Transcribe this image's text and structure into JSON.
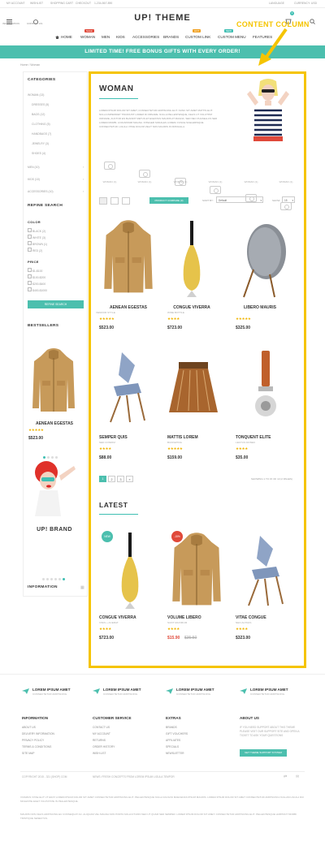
{
  "topbar": {
    "links": [
      "My Account",
      "Wishlist",
      "Shopping Cart",
      "Checkout",
      "1-234-567-890"
    ],
    "lang": "Language",
    "currency": "Currency: USD"
  },
  "header": {
    "logo": "UP! THEME",
    "left_icons": [
      "Information",
      "Contact Us"
    ],
    "cart_count": "3"
  },
  "nav": {
    "items": [
      "Home",
      "Woman",
      "Men",
      "Kids",
      "Accessories",
      "Brands",
      "Custom Link",
      "Custom Menu",
      "Features"
    ],
    "tags": [
      "Sale",
      "Hot",
      "New"
    ]
  },
  "promo": "LIMITED TIME! FREE BONUS GIFTS WITH EVERY ORDER!",
  "callout": "CONTENT COLUMN",
  "breadcrumb": "Home / Woman",
  "sidebar": {
    "categories_title": "Categories",
    "categories": [
      {
        "label": "Woman (13)",
        "active": true
      },
      {
        "label": "Dresses (5)"
      },
      {
        "label": "Bags (12)"
      },
      {
        "label": "Clothing (5)"
      },
      {
        "label": "Handbags (7)"
      },
      {
        "label": "Jewelry (3)"
      },
      {
        "label": "Shoes (4)"
      },
      {
        "label": "Men (10)"
      },
      {
        "label": "Kids (10)"
      },
      {
        "label": "Accessories (10)"
      }
    ],
    "refine_title": "Refine Search",
    "color_title": "Color",
    "colors": [
      "Black (2)",
      "White (3)",
      "Brown (1)",
      "Red (2)"
    ],
    "price_title": "Price",
    "prices": [
      "$1-$100",
      "$100-$200",
      "$200-$400",
      "$400-$1000"
    ],
    "refine_button": "Refine Search",
    "bestsellers_title": "Bestsellers",
    "bestseller_name": "Aenean Egestas",
    "bestseller_rating": "★★★★★",
    "bestseller_price": "$523.00",
    "brand_text": "UP! BRAND",
    "information_title": "Information"
  },
  "content": {
    "title": "WOMAN",
    "description": "LOREM IPSUM DOLOR SIT AMET, CONSECTETUR ADIPISCING ELIT. NUNC SIT AMET MATTIS ELIT. NULLA IMPERDIET TINCIDUNT LOREM ID ORNARE. NULLA PELLENTESQUE, FELIS UT VOLUTPAT ORNARE, AUCTOR EN BLANDIT METUS ET EGESTAS MAURIS AT MAGNA. SED NEC PHASELLUS SED LOREM MORBI. A DIGNISSIM MAGNA. INTEGER SODALES LOREM. FUSCE SCELERISQUE CONSECTETUR. LIGULA VITAE DOLOR VELIT NON MAURIS IN FRINGILLA.",
    "subcategories": [
      "Woman (1)",
      "Woman (1)",
      "Woman (1)",
      "Woman (1)",
      "Woman (1)",
      "Woman (1)"
    ],
    "toolbar": {
      "compare_button": "Product Compare (0)",
      "sort_label": "Sort By:",
      "sort_value": "Default",
      "show_label": "Show:",
      "show_value": "15"
    },
    "products": [
      {
        "name": "Aenean Egestas",
        "sub": "Vendor Style",
        "rating": "★★★★★",
        "price": "$523.00"
      },
      {
        "name": "Congue Viverra",
        "sub": "Wine Bottle",
        "rating": "★★★★",
        "price": "$723.00"
      },
      {
        "name": "Libero Mauris",
        "sub": "Speaker",
        "rating": "★★★★★",
        "price": "$325.00"
      },
      {
        "name": "Semper Quis",
        "sub": "Sed Condim",
        "rating": "★★★★",
        "price": "$88.00"
      },
      {
        "name": "Mattis Lorem",
        "sub": "Bucketing",
        "rating": "★★★★★",
        "price": "$159.00"
      },
      {
        "name": "Tonquent Elite",
        "sub": "Lectus Donec",
        "rating": "★★★★",
        "price": "$35.00"
      }
    ],
    "pagination": [
      "1",
      "2",
      "3",
      "»"
    ],
    "showing": "SHOWING 1 TO 15 OF 13 (2 PAGES)",
    "latest_title": "LATEST",
    "latest": [
      {
        "name": "Congue Viverra",
        "sub": "Vinis + Acerat",
        "rating": "★★★★",
        "price": "$723.00",
        "badge": "New",
        "badge_color": "#4cbfae"
      },
      {
        "name": "Volume Libero",
        "sub": "Sunt Maximum",
        "rating": "★★★★",
        "price": "$15.90",
        "old_price": "$35.50",
        "badge": "-15%",
        "badge_color": "#e0493a"
      },
      {
        "name": "Vitae Congue",
        "sub": "Neo Altavia",
        "rating": "★★★★",
        "price": "$323.00"
      }
    ]
  },
  "footer": {
    "features": [
      {
        "title": "LOREM IPSUM AMET",
        "sub": "Consectetur Adipiscing"
      },
      {
        "title": "LOREM IPSUM AMET",
        "sub": "Consectetur Adipiscing"
      },
      {
        "title": "LOREM IPSUM AMET",
        "sub": "Consectetur Adipiscing"
      },
      {
        "title": "LOREM IPSUM AMET",
        "sub": "Consectetur Adipiscing"
      }
    ],
    "columns": [
      {
        "title": "Information",
        "links": [
          "About Us",
          "Delivery Information",
          "Privacy Policy",
          "Terms & Conditions",
          "Site Map"
        ]
      },
      {
        "title": "Customer Service",
        "links": [
          "Contact Us",
          "My Account",
          "Returns",
          "Order History",
          "Wish List"
        ]
      },
      {
        "title": "Extras",
        "links": [
          "Brands",
          "Gift Vouchers",
          "Affiliates",
          "Specials",
          "Newsletter"
        ]
      }
    ],
    "about_title": "About Us",
    "about_text": "IF YOU NEED SUPPORT ABOUT THIS THEME PLEASE VISIT OUR SUPPORT SITE AND OPEN A TICKET TO ASK YOUR QUESTIONS",
    "support_button": "Get Theme Support System",
    "copyright": "COPYRIGHT 2015 - 321 (SHOP) COM",
    "news": "NEWS: FRESH CONCEPTS FROM LOREM IPSUM LIGULA TEMPOR",
    "legal_1": "VIVAMUS VITAE ELIT UT ERAT LOREM IPSUM DOLOR SIT AMET CONSECTETUR ADIPISCING ELIT. PELLENTESQUE NULLA FACILISI MAECENAS IPSUM MAURIS. LOREM IPSUM DOLOR SIT AMET CONSECTETUR ADIPISCING NULLAM LIGULA DUI MOLESTIE EGET VULPUTATE IN PELLENTESQUE.",
    "legal_2": "MAURIS NON FELIS ADIPISCING EU CONSEQUAT AC. ALIQUAM VEL MAGNA NON PORTA SOLLICITUDIN SED UT QUAM SED SEMPER. LOREM IPSUM DOLOR SIT AMET. CONSECTETUR ADIPISCING ELIT. PELLENTESQUE HABITANT MORBI TRISTIQUE SENECTUS."
  }
}
